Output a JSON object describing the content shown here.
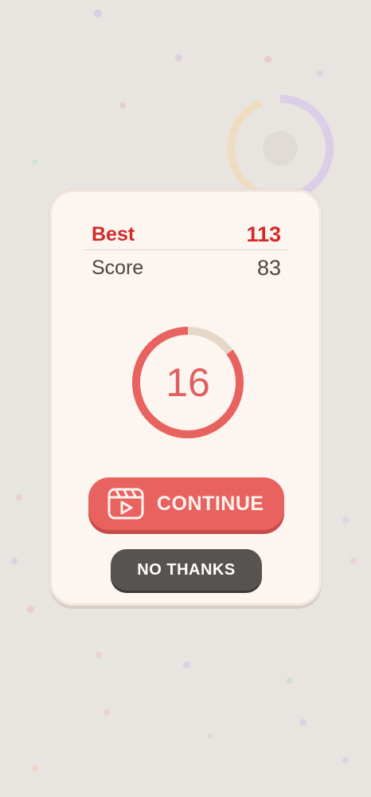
{
  "scores": {
    "best_label": "Best",
    "best_value": "113",
    "score_label": "Score",
    "score_value": "83"
  },
  "countdown": {
    "value": "16",
    "remaining_fraction": 0.85
  },
  "buttons": {
    "continue_label": "CONTINUE",
    "continue_icon": "video-play-icon",
    "no_thanks_label": "NO THANKS"
  },
  "colors": {
    "accent": "#e8625f",
    "best": "#d42a2a",
    "timer_track": "#e6d8c8",
    "dark_button": "#575350"
  }
}
